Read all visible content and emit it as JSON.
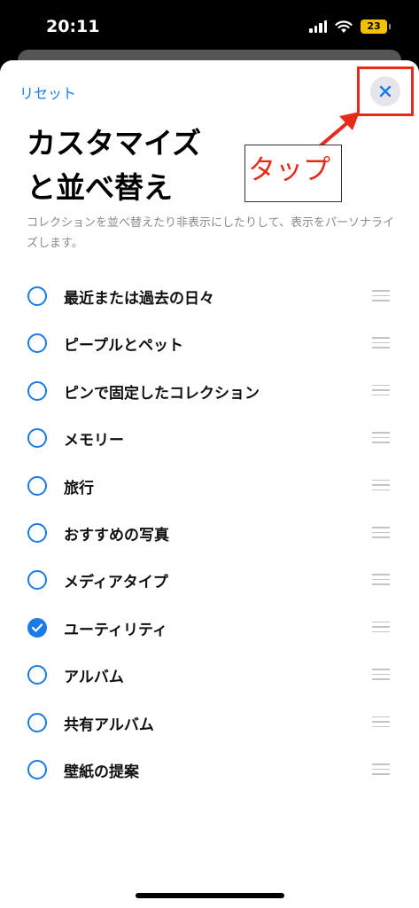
{
  "status_bar": {
    "time": "20:11",
    "battery_level": "23",
    "battery_color": "#f2c100"
  },
  "header": {
    "reset_label": "リセット",
    "close_icon": "close-icon"
  },
  "annotation": {
    "text": "タップ",
    "color": "#e82a1a"
  },
  "page": {
    "title": "カスタマイズ\nと並べ替え",
    "description": "コレクションを並べ替えたり非表示にしたりして、表示をパーソナライズします。"
  },
  "list": {
    "items": [
      {
        "label": "最近または過去の日々",
        "checked": false
      },
      {
        "label": "ピープルとペット",
        "checked": false
      },
      {
        "label": "ピンで固定したコレクション",
        "checked": false
      },
      {
        "label": "メモリー",
        "checked": false
      },
      {
        "label": "旅行",
        "checked": false
      },
      {
        "label": "おすすめの写真",
        "checked": false
      },
      {
        "label": "メディアタイプ",
        "checked": false
      },
      {
        "label": "ユーティリティ",
        "checked": true
      },
      {
        "label": "アルバム",
        "checked": false
      },
      {
        "label": "共有アルバム",
        "checked": false
      },
      {
        "label": "壁紙の提案",
        "checked": false
      }
    ]
  },
  "colors": {
    "accent": "#1a7ae6"
  }
}
